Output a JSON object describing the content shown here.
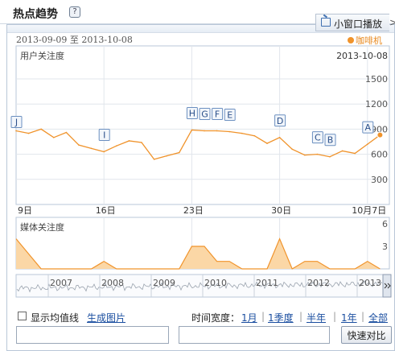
{
  "header": {
    "title": "热点趋势",
    "help_icon": "?"
  },
  "mini_window": {
    "label": "小窗口播放",
    "icon": "tv-icon"
  },
  "date_range": "2013-09-09 至 2013-10-08",
  "legend": {
    "series_name": "咖啡机",
    "color": "#f0932b"
  },
  "colors": {
    "line": "#f0932b",
    "area": "#fbd7a6",
    "grid": "#e1e6ec",
    "border": "#b9c7d8",
    "link": "#1a4ea0"
  },
  "chart_data": [
    {
      "type": "line",
      "title": "用户关注度",
      "date_label": "2013-10-08",
      "y_ticks": [
        "1500",
        "1200",
        "900",
        "600",
        "300"
      ],
      "ylim": [
        0,
        1800
      ],
      "x_ticks": [
        "9日",
        "16日",
        "23日",
        "30日",
        "10月7日"
      ],
      "x": [
        "2013-09-09",
        "2013-09-10",
        "2013-09-11",
        "2013-09-12",
        "2013-09-13",
        "2013-09-14",
        "2013-09-15",
        "2013-09-16",
        "2013-09-17",
        "2013-09-18",
        "2013-09-19",
        "2013-09-20",
        "2013-09-21",
        "2013-09-22",
        "2013-09-23",
        "2013-09-24",
        "2013-09-25",
        "2013-09-26",
        "2013-09-27",
        "2013-09-28",
        "2013-09-29",
        "2013-09-30",
        "2013-10-01",
        "2013-10-02",
        "2013-10-03",
        "2013-10-04",
        "2013-10-05",
        "2013-10-06",
        "2013-10-07",
        "2013-10-08"
      ],
      "values": [
        880,
        850,
        900,
        800,
        860,
        710,
        670,
        630,
        700,
        760,
        740,
        540,
        580,
        620,
        890,
        880,
        880,
        870,
        850,
        820,
        730,
        800,
        660,
        590,
        600,
        570,
        640,
        610,
        720,
        830
      ],
      "annotations": [
        {
          "letter": "J",
          "date": "2013-09-09"
        },
        {
          "letter": "I",
          "date": "2013-09-16"
        },
        {
          "letter": "H",
          "date": "2013-09-23"
        },
        {
          "letter": "G",
          "date": "2013-09-24"
        },
        {
          "letter": "F",
          "date": "2013-09-25"
        },
        {
          "letter": "E",
          "date": "2013-09-26"
        },
        {
          "letter": "D",
          "date": "2013-09-30"
        },
        {
          "letter": "C",
          "date": "2013-10-03"
        },
        {
          "letter": "B",
          "date": "2013-10-04"
        },
        {
          "letter": "A",
          "date": "2013-10-07"
        }
      ]
    },
    {
      "type": "area",
      "title": "媒体关注度",
      "y_ticks": [
        "6",
        "3"
      ],
      "ylim": [
        0,
        6
      ],
      "values": [
        4,
        2,
        0,
        0,
        0,
        0,
        0,
        1,
        0,
        0,
        0,
        0,
        0,
        0,
        3,
        3,
        1,
        1,
        0,
        0,
        0,
        4,
        0,
        1,
        1,
        0,
        0,
        0,
        1,
        0
      ]
    },
    {
      "type": "line",
      "title": "",
      "x_ticks": [
        "2007",
        "2008",
        "2009",
        "2010",
        "2011",
        "2012",
        "2013"
      ]
    }
  ],
  "controls": {
    "show_avg_label": "显示均值线",
    "generate_image": "生成图片",
    "time_width_label": "时间宽度：",
    "time_options": [
      "1月",
      "1季度",
      "半年",
      "1年",
      "全部"
    ],
    "input1_value": "",
    "input2_value": "",
    "compare_button": "快速对比"
  }
}
